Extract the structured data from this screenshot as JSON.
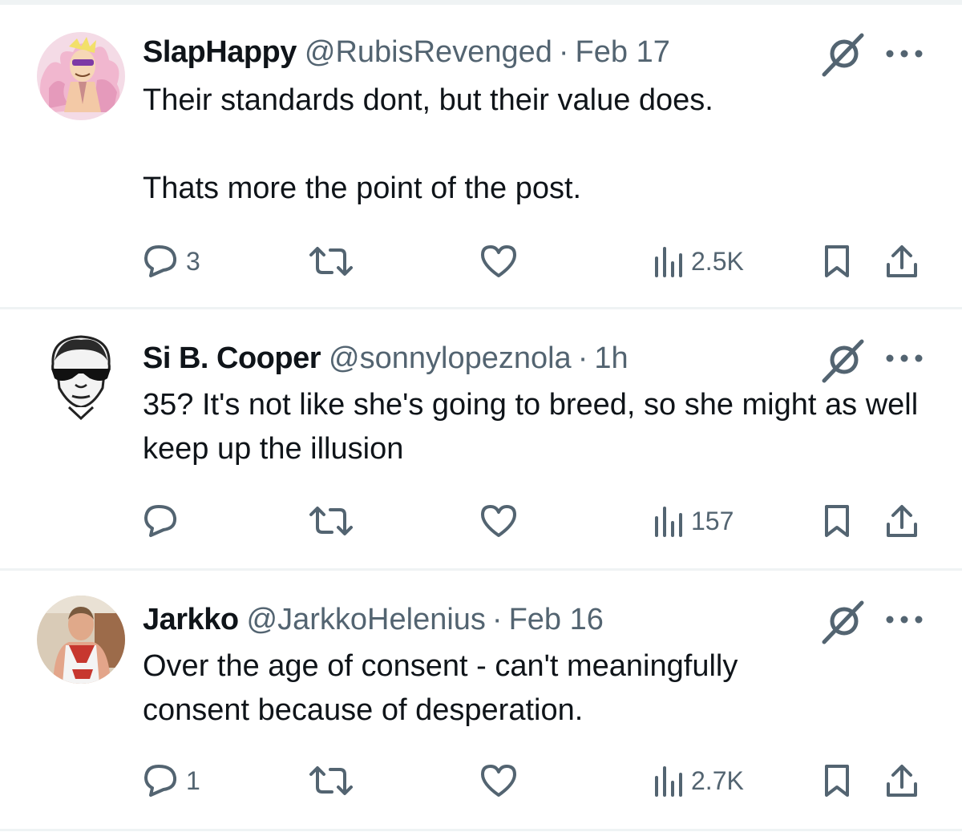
{
  "tweets": [
    {
      "name": "SlapHappy",
      "handle": "@RubisRevenged",
      "separator": "·",
      "time": "Feb 17",
      "text": "Their standards dont, but their value does.\n\nThats more the point of the post.",
      "replies": "3",
      "retweets": "",
      "likes": "",
      "views": "2.5K"
    },
    {
      "name": "Si B. Cooper",
      "handle": "@sonnylopeznola",
      "separator": "·",
      "time": "1h",
      "text": "35? It's not like she's going to breed, so she might as well keep up the illusion",
      "replies": "",
      "retweets": "",
      "likes": "",
      "views": "157"
    },
    {
      "name": "Jarkko",
      "handle": "@JarkkoHelenius",
      "separator": "·",
      "time": "Feb 16",
      "text": "Over the age of consent - can't meaningfully\nconsent because of desperation.",
      "replies": "1",
      "retweets": "",
      "likes": "",
      "views": "2.7K"
    }
  ],
  "icons": {
    "reply": "reply-icon",
    "retweet": "retweet-icon",
    "like": "heart-icon",
    "views": "views-icon",
    "bookmark": "bookmark-icon",
    "share": "share-icon",
    "grok": "grok-icon",
    "more": "more-icon"
  },
  "colors": {
    "text": "#0f1419",
    "secondary": "#536471",
    "divider": "#eff3f4"
  }
}
